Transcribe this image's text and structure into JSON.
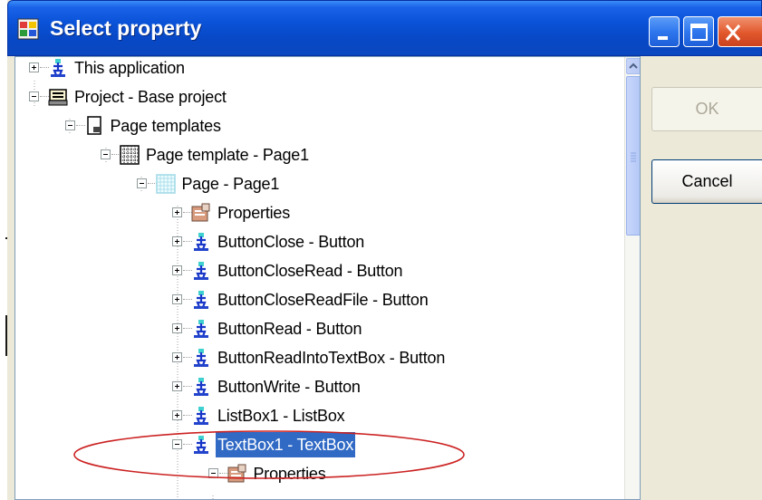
{
  "window": {
    "title": "Select property",
    "icon": "form-window-icon",
    "controls": [
      "minimize-icon",
      "maximize-icon",
      "close-icon"
    ]
  },
  "tree": {
    "nodes": [
      {
        "label": "This application",
        "icon": "app-object-icon",
        "expander": "plus"
      },
      {
        "label": "Project - Base project",
        "icon": "project-icon",
        "expander": "minus"
      },
      {
        "label": "Page templates",
        "icon": "page-templates-icon",
        "expander": "minus"
      },
      {
        "label": "Page template - Page1",
        "icon": "page-template-icon",
        "expander": "minus"
      },
      {
        "label": "Page - Page1",
        "icon": "page-icon",
        "expander": "minus"
      },
      {
        "label": "Properties",
        "icon": "properties-icon",
        "expander": "plus"
      },
      {
        "label": "ButtonClose - Button",
        "icon": "app-object-icon",
        "expander": "plus"
      },
      {
        "label": "ButtonCloseRead - Button",
        "icon": "app-object-icon",
        "expander": "plus"
      },
      {
        "label": "ButtonCloseReadFile - Button",
        "icon": "app-object-icon",
        "expander": "plus"
      },
      {
        "label": "ButtonRead - Button",
        "icon": "app-object-icon",
        "expander": "plus"
      },
      {
        "label": "ButtonReadIntoTextBox - Button",
        "icon": "app-object-icon",
        "expander": "plus"
      },
      {
        "label": "ButtonWrite - Button",
        "icon": "app-object-icon",
        "expander": "plus"
      },
      {
        "label": "ListBox1 - ListBox",
        "icon": "app-object-icon",
        "expander": "plus"
      },
      {
        "label": "TextBox1 - TextBox",
        "icon": "app-object-icon",
        "expander": "minus",
        "selected": true
      },
      {
        "label": "Properties",
        "icon": "properties-icon",
        "expander": "minus"
      }
    ]
  },
  "buttons": {
    "ok": "OK",
    "cancel": "Cancel"
  },
  "colors": {
    "titlebar": "#0a52d8",
    "selection": "#316ac5",
    "highlight_oval": "#cc2222",
    "dialog_bg": "#ece9d8"
  }
}
